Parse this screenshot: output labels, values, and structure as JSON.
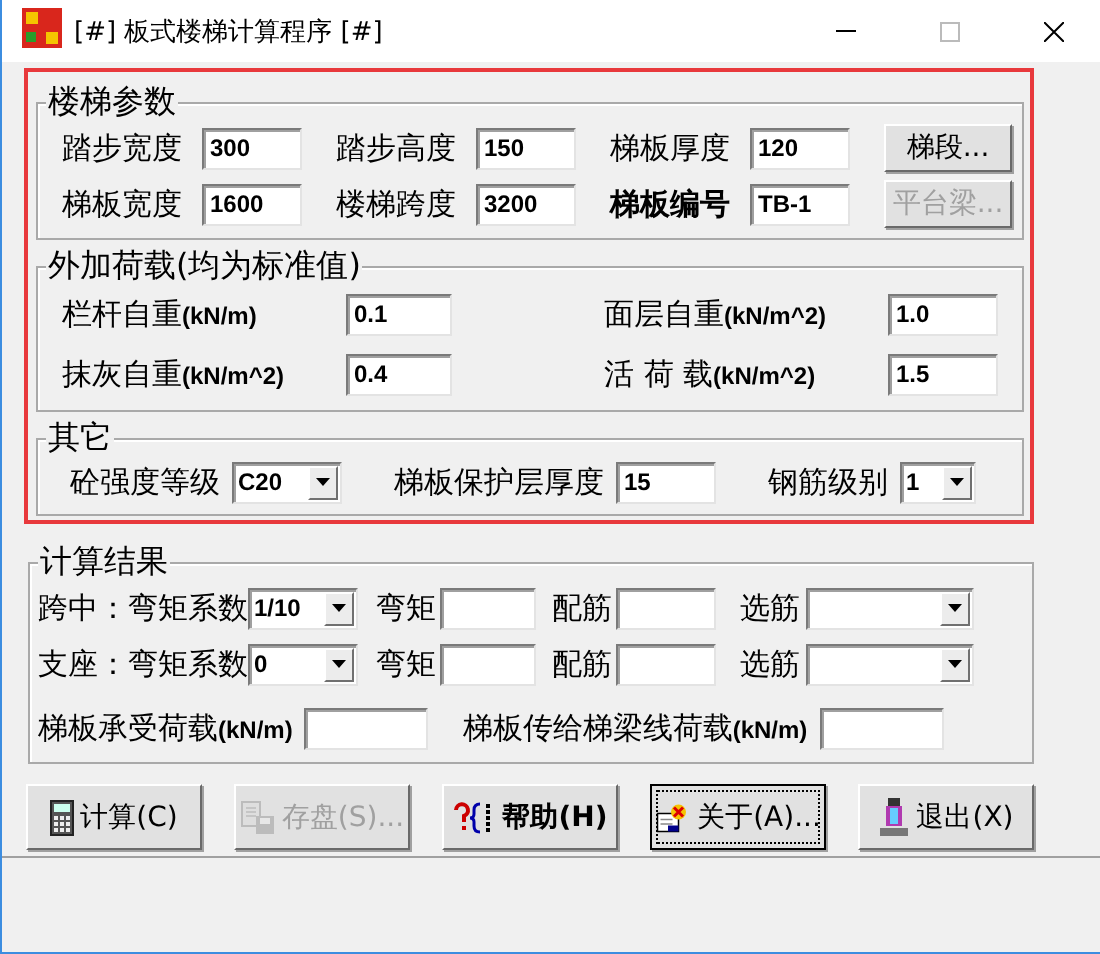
{
  "window": {
    "title": "[#] 板式楼梯计算程序 [#]"
  },
  "highlighted": true,
  "stair_params": {
    "title": "楼梯参数",
    "rows": [
      {
        "fields": [
          {
            "label": "踏步宽度",
            "value": "300",
            "bold": false
          },
          {
            "label": "踏步高度",
            "value": "150",
            "bold": false
          },
          {
            "label": "梯板厚度",
            "value": "120",
            "bold": false
          }
        ],
        "button": {
          "label": "梯段...",
          "disabled": false
        }
      },
      {
        "fields": [
          {
            "label": "梯板宽度",
            "value": "1600",
            "bold": false
          },
          {
            "label": "楼梯跨度",
            "value": "3200",
            "bold": false
          },
          {
            "label": "梯板编号",
            "value": "TB-1",
            "bold": true
          }
        ],
        "button": {
          "label": "平台梁...",
          "disabled": true
        }
      }
    ]
  },
  "extra_loads": {
    "title": "外加荷载(均为标准值)",
    "fields": [
      {
        "label": "栏杆自重**(kN/m)**",
        "value": "0.1"
      },
      {
        "label": "面层自重**(kN/m^2)**",
        "value": "1.0"
      },
      {
        "label": "抹灰自重**(kN/m^2)**",
        "value": "0.4"
      },
      {
        "label": "活 荷 载**(kN/m^2)**",
        "value": "1.5"
      }
    ]
  },
  "other": {
    "title": "其它",
    "items": [
      {
        "kind": "dropdown",
        "label": "砼强度等级",
        "value": "C20"
      },
      {
        "kind": "text",
        "label": "梯板保护层厚度",
        "value": "15"
      },
      {
        "kind": "dropdown",
        "label": "钢筋级别",
        "value": "1"
      }
    ]
  },
  "results": {
    "title": "计算结果",
    "rows": [
      {
        "label": "跨中：弯矩系数",
        "coefficient": "1/10",
        "moment_label": "弯矩",
        "rebar_label": "配筋",
        "select_label": "选筋"
      },
      {
        "label": "支座：弯矩系数",
        "coefficient": "0",
        "moment_label": "弯矩",
        "rebar_label": "配筋",
        "select_label": "选筋"
      }
    ],
    "loads": [
      {
        "label": "梯板承受荷载**(kN/m)**"
      },
      {
        "label": "梯板传给梯梁线荷载**(kN/m)**"
      }
    ]
  },
  "buttons": [
    {
      "kind": "calculate",
      "label": "计算(C)",
      "disabled": false,
      "focused": false,
      "bold": false
    },
    {
      "kind": "save",
      "label": "存盘(S)...",
      "disabled": true,
      "focused": false,
      "bold": false
    },
    {
      "kind": "help",
      "label": "帮助(H)",
      "disabled": false,
      "focused": false,
      "bold": true
    },
    {
      "kind": "about",
      "label": "关于(A)...",
      "disabled": false,
      "focused": true,
      "bold": false
    },
    {
      "kind": "exit",
      "label": "退出(X)",
      "disabled": false,
      "focused": false,
      "bold": false
    }
  ]
}
